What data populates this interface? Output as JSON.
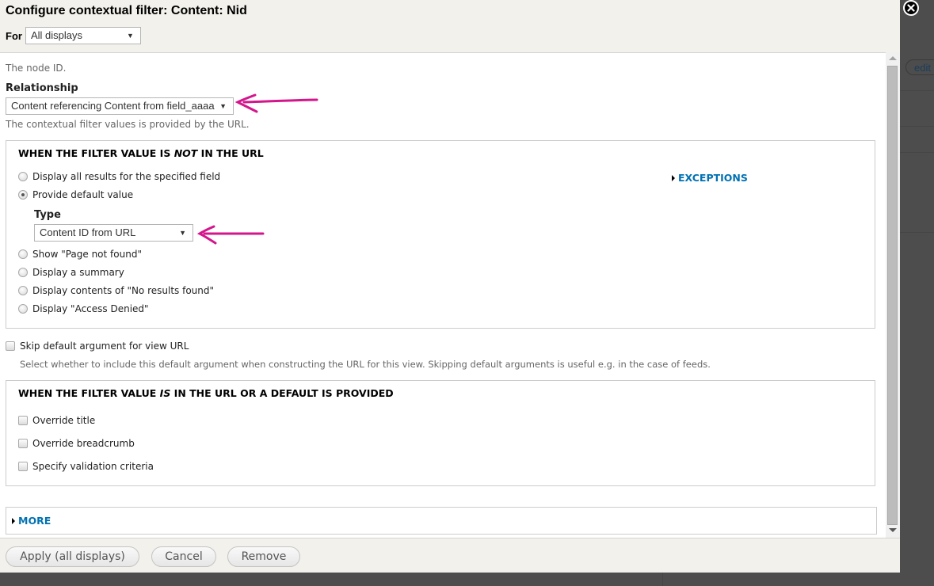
{
  "dialog": {
    "title": "Configure contextual filter: Content: Nid",
    "for_label": "For",
    "for_select": {
      "value": "All displays"
    },
    "close_icon": "close-circle-icon"
  },
  "backdrop": {
    "edit_label": "edit"
  },
  "form": {
    "description": "The node ID.",
    "relationship": {
      "label": "Relationship",
      "value": "Content referencing Content from field_aaaa",
      "help": "The contextual filter values is provided by the URL."
    },
    "not_in_url": {
      "legend_pre": "WHEN THE FILTER VALUE IS ",
      "legend_em": "NOT",
      "legend_post": " IN THE URL",
      "options": [
        {
          "label": "Display all results for the specified field",
          "checked": false
        },
        {
          "label": "Provide default value",
          "checked": true
        },
        {
          "label": "Show \"Page not found\"",
          "checked": false
        },
        {
          "label": "Display a summary",
          "checked": false
        },
        {
          "label": "Display contents of \"No results found\"",
          "checked": false
        },
        {
          "label": "Display \"Access Denied\"",
          "checked": false
        }
      ],
      "type": {
        "label": "Type",
        "value": "Content ID from URL"
      },
      "exceptions_label": "EXCEPTIONS"
    },
    "skip_default": {
      "label": "Skip default argument for view URL",
      "checked": false,
      "help": "Select whether to include this default argument when constructing the URL for this view. Skipping default arguments is useful e.g. in the case of feeds."
    },
    "is_in_url": {
      "legend_pre": "WHEN THE FILTER VALUE ",
      "legend_em": "IS",
      "legend_post": " IN THE URL OR A DEFAULT IS PROVIDED",
      "checkboxes": [
        {
          "label": "Override title",
          "checked": false
        },
        {
          "label": "Override breadcrumb",
          "checked": false
        },
        {
          "label": "Specify validation criteria",
          "checked": false
        }
      ]
    },
    "more_label": "MORE"
  },
  "buttons": {
    "apply": "Apply (all displays)",
    "cancel": "Cancel",
    "remove": "Remove"
  },
  "colors": {
    "link": "#0071b3",
    "annotation": "#d4158c",
    "dialog_bg": "#f2f1eb",
    "backdrop": "#4d4d4d"
  }
}
